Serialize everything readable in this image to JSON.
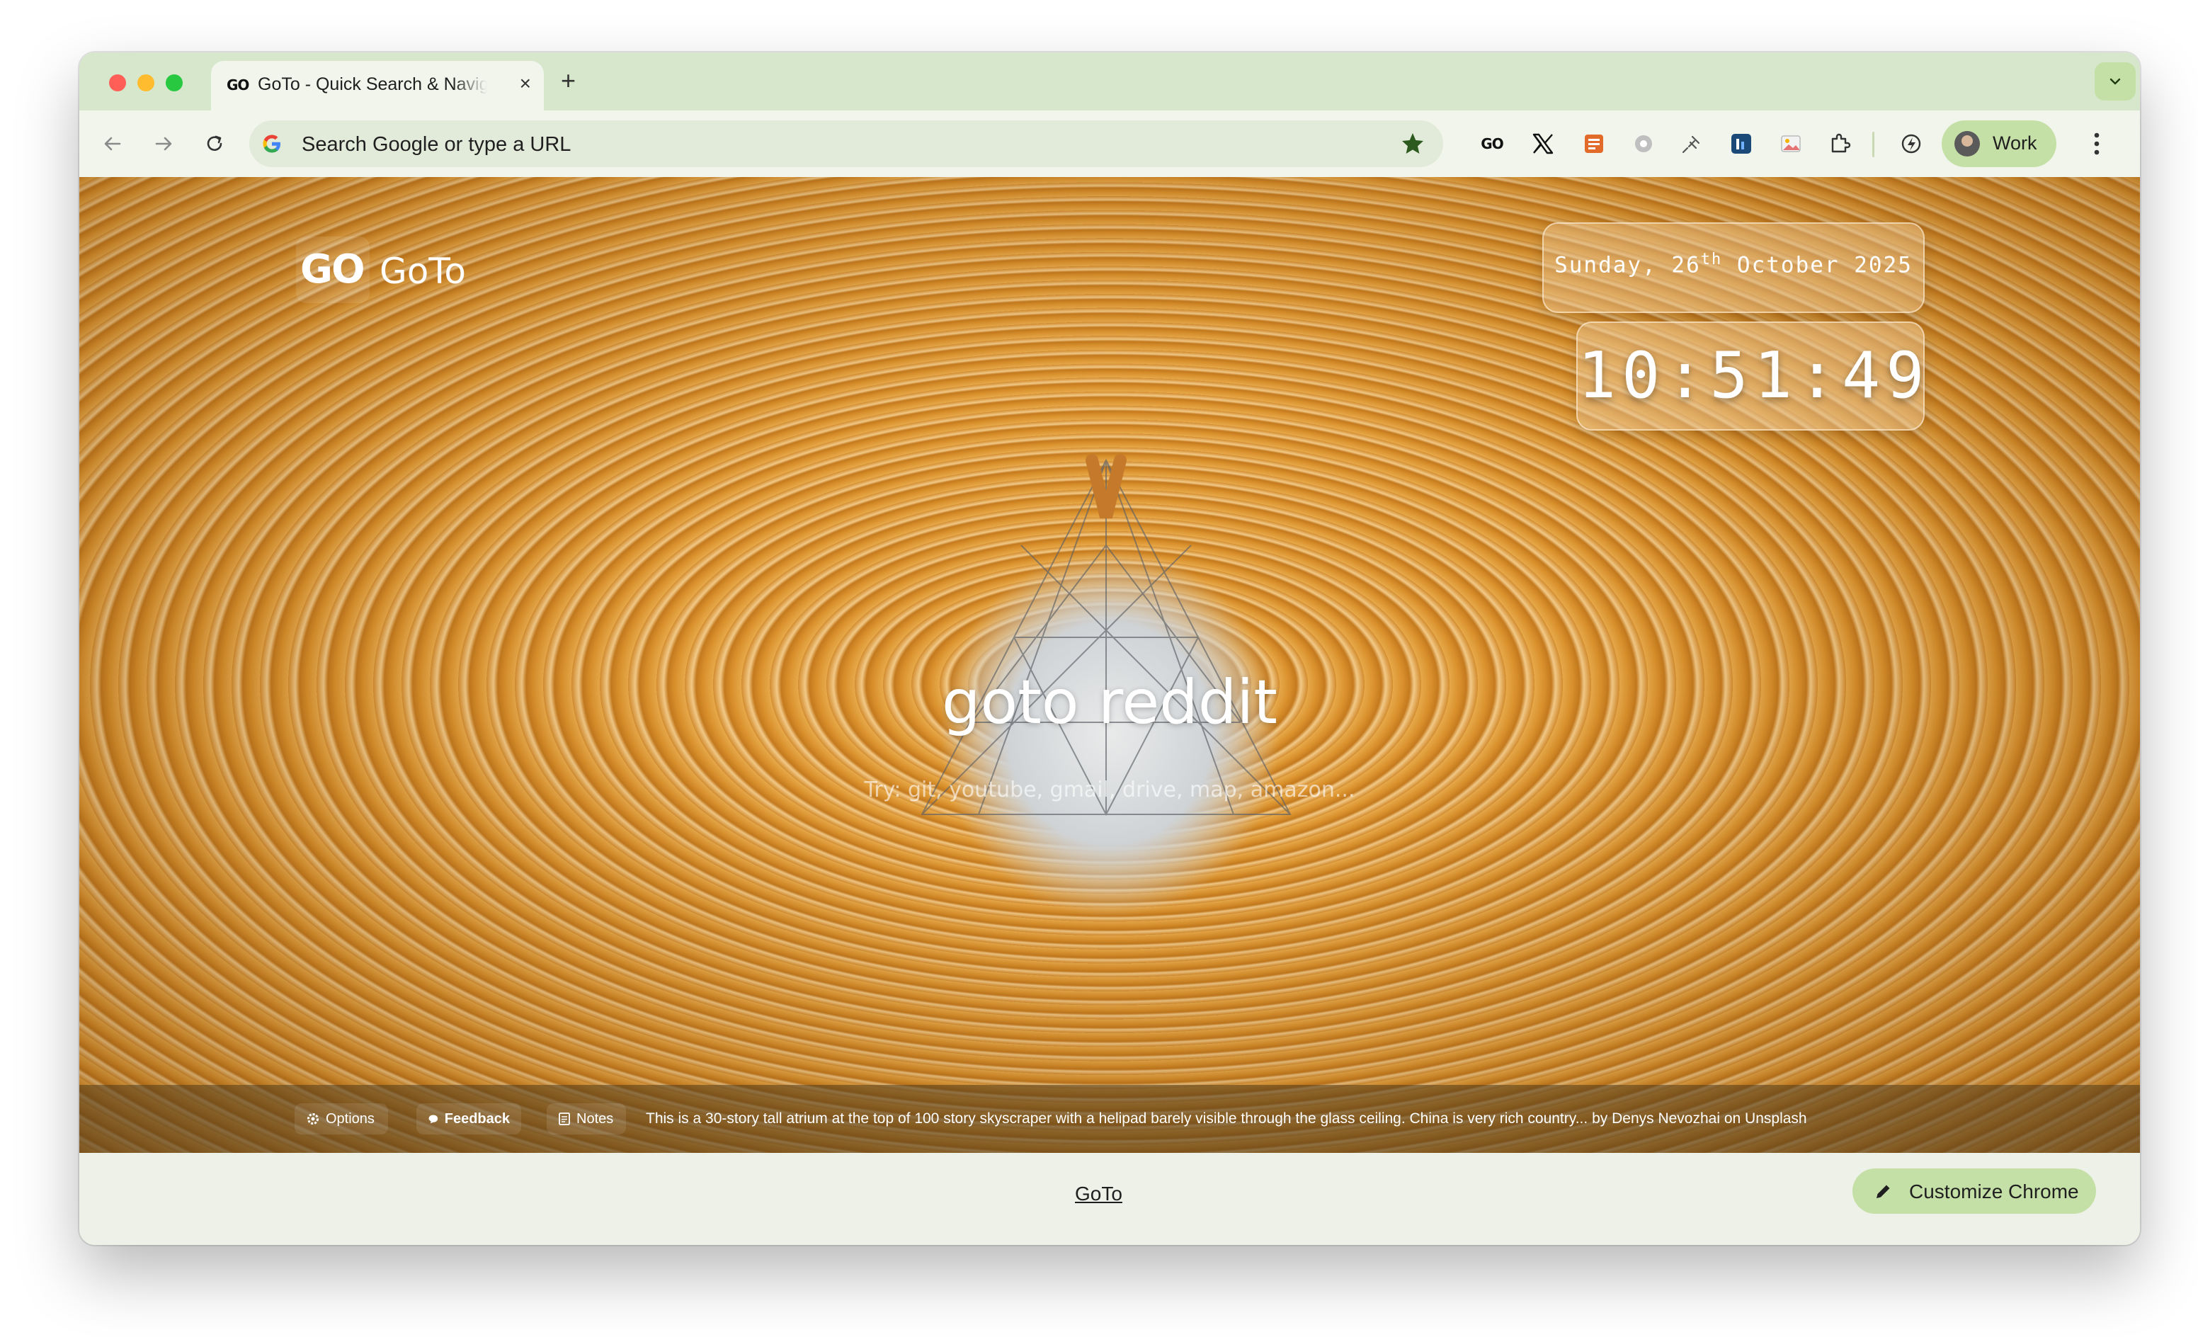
{
  "browser": {
    "tab": {
      "favicon_text": "GO",
      "title": "GoTo - Quick Search & Navigation",
      "close_glyph": "×"
    },
    "new_tab_glyph": "+",
    "omnibox": {
      "placeholder": "Search Google or type a URL"
    },
    "extensions": [
      "goto-ext-icon",
      "x-icon",
      "orange-app-icon",
      "gray-app-icon",
      "pin-app-icon",
      "blue-app-icon",
      "photos-icon",
      "puzzle-icon"
    ],
    "profile": {
      "label": "Work"
    },
    "accent_color": "#c4e0a6",
    "frame_color": "#d6e7cc"
  },
  "page": {
    "logo": {
      "mark": "GO",
      "name": "GoTo"
    },
    "date": {
      "weekday": "Sunday, 26",
      "ordinal": "th",
      "rest": " October 2025"
    },
    "time": "10:51:49",
    "query": "goto reddit",
    "hint": "Try: git, youtube, gmail, drive, map, amazon..."
  },
  "footer": {
    "options_label": "Options",
    "feedback_label": "Feedback",
    "notes_label": "Notes",
    "photo_caption": "This is a 30-story tall atrium at the top of 100 story skyscraper with a helipad barely visible through the glass ceiling. China is very rich country...",
    "by_text": "by",
    "author": "Denys Nevozhai",
    "on_text": "on",
    "source": "Unsplash"
  },
  "bottom": {
    "link": "GoTo",
    "customize_label": "Customize Chrome"
  }
}
